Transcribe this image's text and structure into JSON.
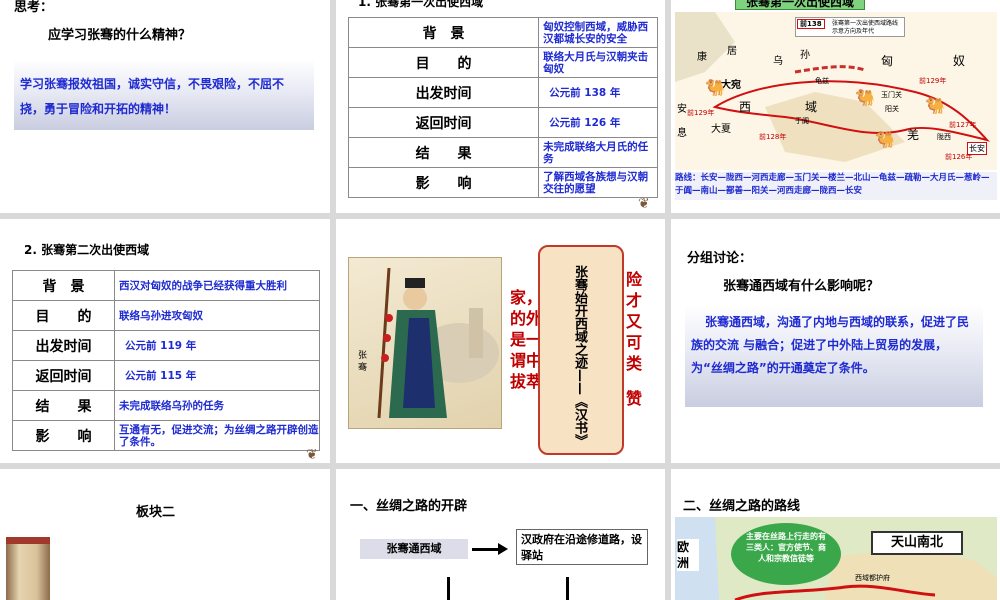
{
  "slide1": {
    "heading": "思考：",
    "question": "应学习张骞的什么精神？",
    "answer": "学习张骞报效祖国，诚实守信，不畏艰险，不屈不挠，勇于冒险和开拓的精神！"
  },
  "slide2": {
    "title": "1. 张骞第一次出使西域",
    "rows": [
      {
        "key": "背　景",
        "value": "匈奴控制西域，威胁西汉都城长安的安全"
      },
      {
        "key": "目　　的",
        "value": "联络大月氏与汉朝夹击匈奴"
      },
      {
        "key": "出发时间",
        "value": "公元前 138 年"
      },
      {
        "key": "返回时间",
        "value": "公元前 126 年"
      },
      {
        "key": "结　　果",
        "value": "未完成联络大月氏的任务"
      },
      {
        "key": "影　　响",
        "value": "了解西域各族想与汉朝交往的愿望"
      }
    ]
  },
  "slide3": {
    "title": "张骞第一次出使西域",
    "legend_year": "前138",
    "legend_text": "张骞第一次出使西域路线示意方向及年代",
    "places": [
      "康",
      "居",
      "乌",
      "孙",
      "匈",
      "奴",
      "大宛",
      "西",
      "域",
      "大夏",
      "安",
      "息",
      "羌",
      "阳关",
      "玉门关",
      "长安",
      "陇西",
      "龟兹",
      "于阗"
    ],
    "year_labels": [
      "前129年",
      "前129年",
      "前128年",
      "前127年",
      "前126年"
    ],
    "route_text": "路线：长安—陇西—河西走廊—玉门关—楼兰—北山—龟兹—疏勒—大月氏—葱岭—于阗—南山—鄯善—阳关—河西走廊—陇西—长安"
  },
  "slide4": {
    "title": "2. 张骞第二次出使西域",
    "rows": [
      {
        "key": "背　景",
        "value": "西汉对匈奴的战争已经获得重大胜利"
      },
      {
        "key": "目　　的",
        "value": "联络乌孙进攻匈奴"
      },
      {
        "key": "出发时间",
        "value": "公元前 119 年"
      },
      {
        "key": "返回时间",
        "value": "公元前 115 年"
      },
      {
        "key": "结　　果",
        "value": "未完成联络乌孙的任务"
      },
      {
        "key": "影　　响",
        "value": "互通有无，促进交流；为丝绸之路开辟创造了条件。"
      }
    ]
  },
  "slide5": {
    "portrait_caption": "张 骞",
    "quote_lines": [
      "家，",
      "的外",
      "是一",
      "谓中",
      "拔萃"
    ],
    "quote_right": [
      "险",
      "才",
      "又",
      "可",
      "类",
      "赞"
    ],
    "scroll_text": "张骞始开西域之迹——《汉书》"
  },
  "slide6": {
    "heading": "分组讨论：",
    "question": "张骞通西域有什么影响呢？",
    "answer": "张骞通西域，沟通了内地与西域的联系，促进了民族的交流 与融合；促进了中外陆上贸易的发展，为“丝绸之路”的开通奠定了条件。"
  },
  "slide7": {
    "title": "板块二"
  },
  "slide8": {
    "title": "一、丝绸之路的开辟",
    "box_left": "张骞通西域",
    "box_right": "汉政府在沿途修道路，设驿站"
  },
  "slide9": {
    "title": "二、丝绸之路的路线",
    "continent": "欧洲",
    "bubble": "主要在丝路上行走的有三类人：官方使节、商人和宗教信徒等",
    "callout": "天山南北",
    "map_label": "西域都护府"
  },
  "colors": {
    "blue_text": "#1f2bd1",
    "red_text": "#c00000",
    "table_border": "#8a8a8a",
    "map_route": "#d01010"
  }
}
